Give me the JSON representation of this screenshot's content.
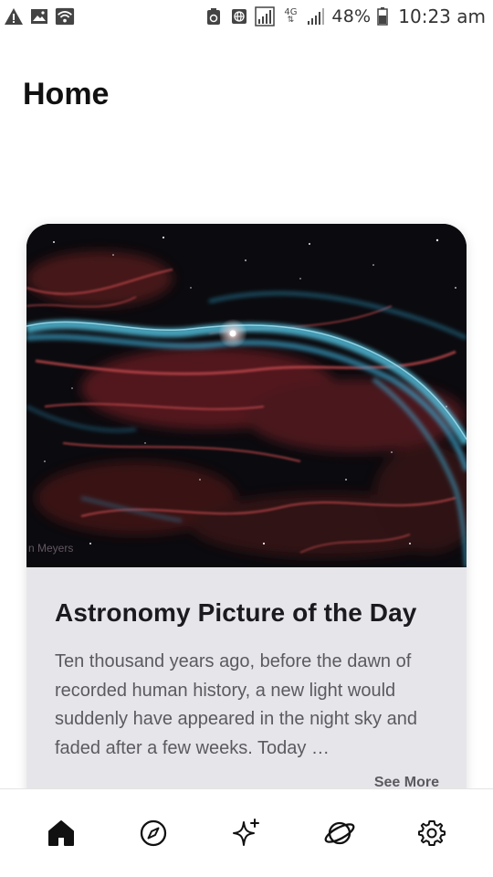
{
  "status_bar": {
    "battery_percent": "48%",
    "time": "10:23 am",
    "network_type": "4G",
    "left_icons": [
      "warning-icon",
      "image-icon",
      "wifi-icon"
    ],
    "right_icons": [
      "recycle-icon",
      "globe-icon",
      "signal-icon",
      "network-4g-icon",
      "signal-icon",
      "battery-icon"
    ]
  },
  "header": {
    "title": "Home"
  },
  "apod_card": {
    "title": "Astronomy Picture of the Day",
    "description": "Ten thousand years ago, before the dawn of recorded human history, a new light would suddenly have appeared in the night sky and faded after a few weeks.  Today …",
    "image_credit": "n Meyers",
    "see_more_label": "See More"
  },
  "bottom_nav": {
    "items": [
      {
        "icon": "home-icon",
        "active": true
      },
      {
        "icon": "compass-icon",
        "active": false
      },
      {
        "icon": "sparkle-icon",
        "active": false
      },
      {
        "icon": "planet-icon",
        "active": false
      },
      {
        "icon": "gear-icon",
        "active": false
      }
    ]
  },
  "colors": {
    "background": "#ffffff",
    "card_background": "#e6e6ea",
    "title_text": "#111111",
    "body_text": "#5a5a60"
  }
}
